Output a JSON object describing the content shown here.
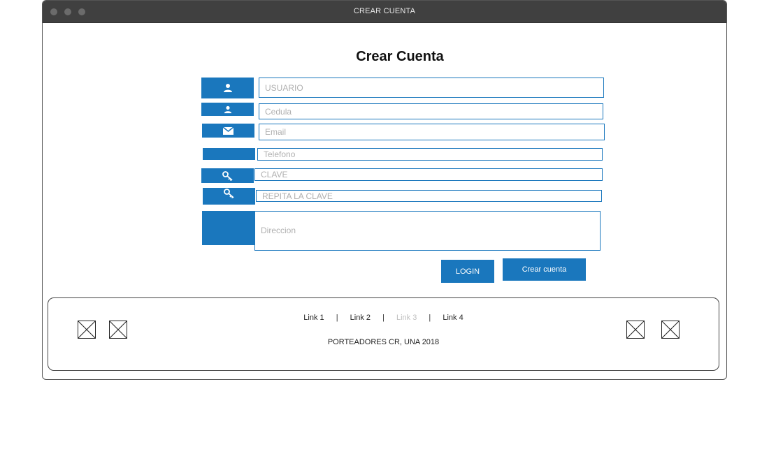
{
  "window": {
    "title": "CREAR CUENTA"
  },
  "form": {
    "heading": "Crear Cuenta",
    "fields": {
      "usuario": {
        "placeholder": "USUARIO",
        "icon": "user-icon"
      },
      "cedula": {
        "placeholder": "Cedula",
        "icon": "user-icon"
      },
      "email": {
        "placeholder": "Email",
        "icon": "envelope-icon"
      },
      "telefono": {
        "placeholder": "Telefono"
      },
      "clave": {
        "placeholder": "CLAVE",
        "icon": "key-icon"
      },
      "repetir": {
        "placeholder": "REPITA LA CLAVE",
        "icon": "key-icon"
      },
      "direccion": {
        "placeholder": "Direccion"
      }
    },
    "buttons": {
      "login": "LOGIN",
      "create": "Crear cuenta"
    }
  },
  "footer": {
    "links": [
      "Link 1",
      "Link 2",
      "Link 3",
      "Link 4"
    ],
    "separator": "|",
    "copyright": "PORTEADORES CR, UNA 2018"
  },
  "colors": {
    "accent": "#1a77bd",
    "titlebar": "#404040",
    "disabled_link": "#c0c0c0"
  }
}
